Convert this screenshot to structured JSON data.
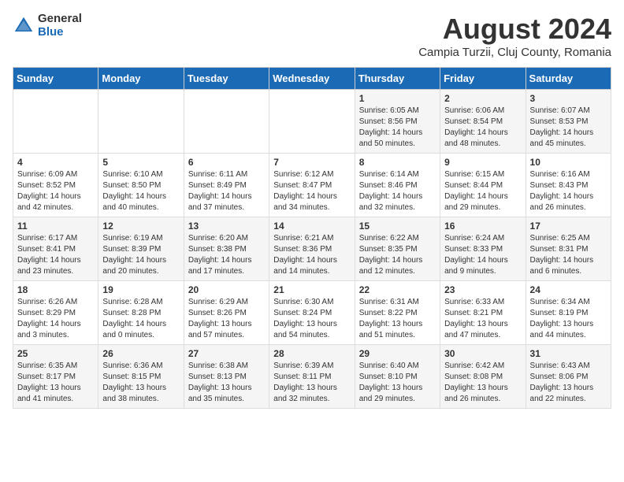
{
  "header": {
    "logo_general": "General",
    "logo_blue": "Blue",
    "month_title": "August 2024",
    "location": "Campia Turzii, Cluj County, Romania"
  },
  "weekdays": [
    "Sunday",
    "Monday",
    "Tuesday",
    "Wednesday",
    "Thursday",
    "Friday",
    "Saturday"
  ],
  "weeks": [
    [
      {
        "day": "",
        "content": ""
      },
      {
        "day": "",
        "content": ""
      },
      {
        "day": "",
        "content": ""
      },
      {
        "day": "",
        "content": ""
      },
      {
        "day": "1",
        "content": "Sunrise: 6:05 AM\nSunset: 8:56 PM\nDaylight: 14 hours\nand 50 minutes."
      },
      {
        "day": "2",
        "content": "Sunrise: 6:06 AM\nSunset: 8:54 PM\nDaylight: 14 hours\nand 48 minutes."
      },
      {
        "day": "3",
        "content": "Sunrise: 6:07 AM\nSunset: 8:53 PM\nDaylight: 14 hours\nand 45 minutes."
      }
    ],
    [
      {
        "day": "4",
        "content": "Sunrise: 6:09 AM\nSunset: 8:52 PM\nDaylight: 14 hours\nand 42 minutes."
      },
      {
        "day": "5",
        "content": "Sunrise: 6:10 AM\nSunset: 8:50 PM\nDaylight: 14 hours\nand 40 minutes."
      },
      {
        "day": "6",
        "content": "Sunrise: 6:11 AM\nSunset: 8:49 PM\nDaylight: 14 hours\nand 37 minutes."
      },
      {
        "day": "7",
        "content": "Sunrise: 6:12 AM\nSunset: 8:47 PM\nDaylight: 14 hours\nand 34 minutes."
      },
      {
        "day": "8",
        "content": "Sunrise: 6:14 AM\nSunset: 8:46 PM\nDaylight: 14 hours\nand 32 minutes."
      },
      {
        "day": "9",
        "content": "Sunrise: 6:15 AM\nSunset: 8:44 PM\nDaylight: 14 hours\nand 29 minutes."
      },
      {
        "day": "10",
        "content": "Sunrise: 6:16 AM\nSunset: 8:43 PM\nDaylight: 14 hours\nand 26 minutes."
      }
    ],
    [
      {
        "day": "11",
        "content": "Sunrise: 6:17 AM\nSunset: 8:41 PM\nDaylight: 14 hours\nand 23 minutes."
      },
      {
        "day": "12",
        "content": "Sunrise: 6:19 AM\nSunset: 8:39 PM\nDaylight: 14 hours\nand 20 minutes."
      },
      {
        "day": "13",
        "content": "Sunrise: 6:20 AM\nSunset: 8:38 PM\nDaylight: 14 hours\nand 17 minutes."
      },
      {
        "day": "14",
        "content": "Sunrise: 6:21 AM\nSunset: 8:36 PM\nDaylight: 14 hours\nand 14 minutes."
      },
      {
        "day": "15",
        "content": "Sunrise: 6:22 AM\nSunset: 8:35 PM\nDaylight: 14 hours\nand 12 minutes."
      },
      {
        "day": "16",
        "content": "Sunrise: 6:24 AM\nSunset: 8:33 PM\nDaylight: 14 hours\nand 9 minutes."
      },
      {
        "day": "17",
        "content": "Sunrise: 6:25 AM\nSunset: 8:31 PM\nDaylight: 14 hours\nand 6 minutes."
      }
    ],
    [
      {
        "day": "18",
        "content": "Sunrise: 6:26 AM\nSunset: 8:29 PM\nDaylight: 14 hours\nand 3 minutes."
      },
      {
        "day": "19",
        "content": "Sunrise: 6:28 AM\nSunset: 8:28 PM\nDaylight: 14 hours\nand 0 minutes."
      },
      {
        "day": "20",
        "content": "Sunrise: 6:29 AM\nSunset: 8:26 PM\nDaylight: 13 hours\nand 57 minutes."
      },
      {
        "day": "21",
        "content": "Sunrise: 6:30 AM\nSunset: 8:24 PM\nDaylight: 13 hours\nand 54 minutes."
      },
      {
        "day": "22",
        "content": "Sunrise: 6:31 AM\nSunset: 8:22 PM\nDaylight: 13 hours\nand 51 minutes."
      },
      {
        "day": "23",
        "content": "Sunrise: 6:33 AM\nSunset: 8:21 PM\nDaylight: 13 hours\nand 47 minutes."
      },
      {
        "day": "24",
        "content": "Sunrise: 6:34 AM\nSunset: 8:19 PM\nDaylight: 13 hours\nand 44 minutes."
      }
    ],
    [
      {
        "day": "25",
        "content": "Sunrise: 6:35 AM\nSunset: 8:17 PM\nDaylight: 13 hours\nand 41 minutes."
      },
      {
        "day": "26",
        "content": "Sunrise: 6:36 AM\nSunset: 8:15 PM\nDaylight: 13 hours\nand 38 minutes."
      },
      {
        "day": "27",
        "content": "Sunrise: 6:38 AM\nSunset: 8:13 PM\nDaylight: 13 hours\nand 35 minutes."
      },
      {
        "day": "28",
        "content": "Sunrise: 6:39 AM\nSunset: 8:11 PM\nDaylight: 13 hours\nand 32 minutes."
      },
      {
        "day": "29",
        "content": "Sunrise: 6:40 AM\nSunset: 8:10 PM\nDaylight: 13 hours\nand 29 minutes."
      },
      {
        "day": "30",
        "content": "Sunrise: 6:42 AM\nSunset: 8:08 PM\nDaylight: 13 hours\nand 26 minutes."
      },
      {
        "day": "31",
        "content": "Sunrise: 6:43 AM\nSunset: 8:06 PM\nDaylight: 13 hours\nand 22 minutes."
      }
    ]
  ]
}
